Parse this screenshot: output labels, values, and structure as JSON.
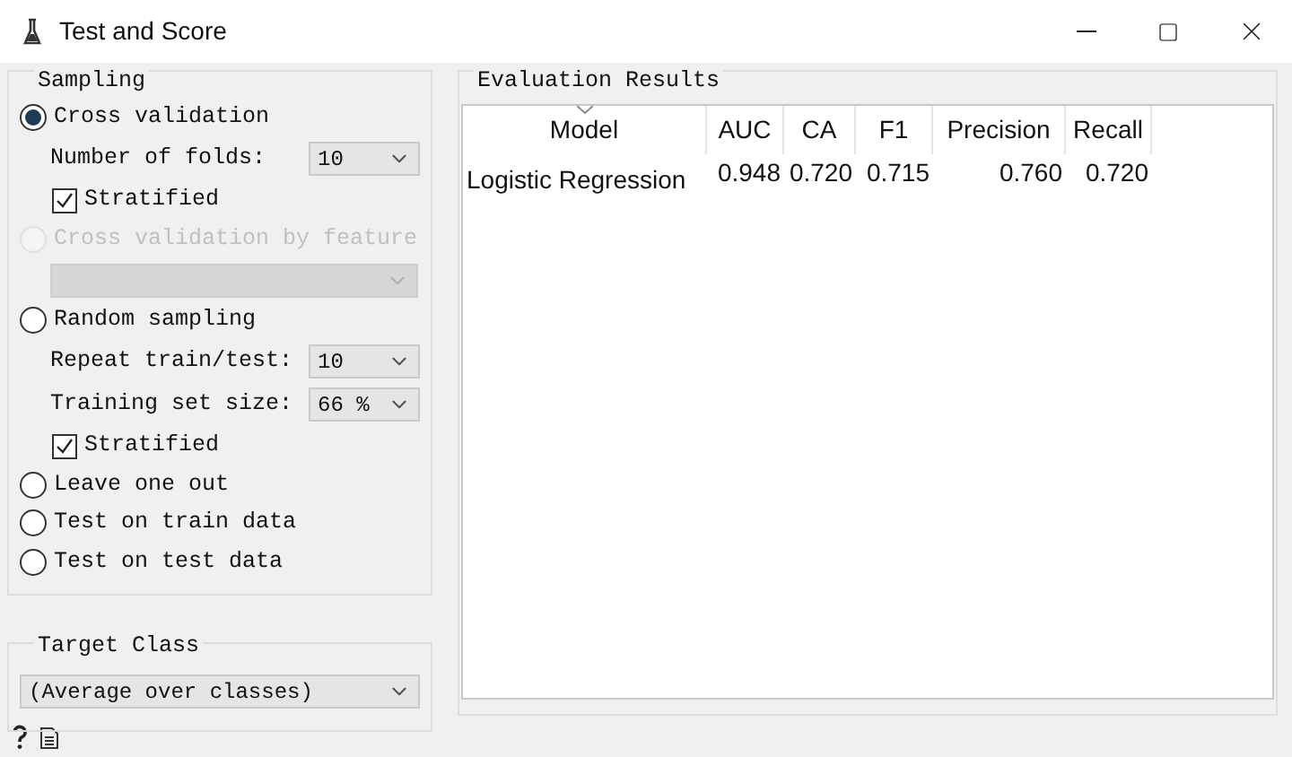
{
  "window": {
    "title": "Test and Score"
  },
  "sampling": {
    "title": "Sampling",
    "items": [
      {
        "kind": "radio",
        "label": "Cross validation",
        "selected": true,
        "disabled": false
      },
      {
        "kind": "combo",
        "label": "Number of folds:",
        "value": "10",
        "disabled": false
      },
      {
        "kind": "checkbox",
        "label": "Stratified",
        "checked": true
      },
      {
        "kind": "radio",
        "label": "Cross validation by feature",
        "selected": false,
        "disabled": true
      },
      {
        "kind": "combo",
        "value": "",
        "disabled": true
      },
      {
        "kind": "radio",
        "label": "Random sampling",
        "selected": false,
        "disabled": false
      },
      {
        "kind": "combo",
        "label": "Repeat train/test:",
        "value": "10",
        "disabled": false
      },
      {
        "kind": "combo",
        "label": "Training set size:",
        "value": "66 %",
        "disabled": false
      },
      {
        "kind": "checkbox",
        "label": "Stratified",
        "checked": true
      },
      {
        "kind": "radio",
        "label": "Leave one out",
        "selected": false,
        "disabled": false
      },
      {
        "kind": "radio",
        "label": "Test on train data",
        "selected": false,
        "disabled": false
      },
      {
        "kind": "radio",
        "label": "Test on test data",
        "selected": false,
        "disabled": false
      }
    ]
  },
  "target_class": {
    "title": "Target Class",
    "value": "(Average over classes)"
  },
  "results": {
    "title": "Evaluation Results",
    "columns": [
      "Model",
      "AUC",
      "CA",
      "F1",
      "Precision",
      "Recall"
    ],
    "rows": [
      [
        "Logistic Regression",
        "0.948",
        "0.720",
        "0.715",
        "0.760",
        "0.720"
      ]
    ]
  }
}
